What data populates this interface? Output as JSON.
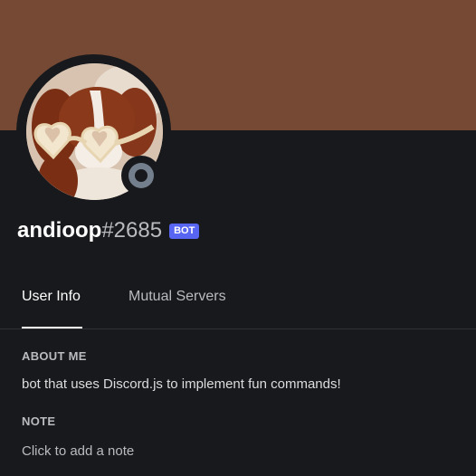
{
  "profile": {
    "username": "andioop",
    "discriminator": "#2685",
    "bot_tag": "BOT",
    "banner_color": "#754933",
    "status": "offline",
    "avatar_icon": "puppy-with-heart-sunglasses-avatar"
  },
  "tabs": [
    {
      "label": "User Info",
      "active": true
    },
    {
      "label": "Mutual Servers",
      "active": false
    }
  ],
  "about": {
    "title": "ABOUT ME",
    "text": "bot that uses Discord.js to implement fun commands!"
  },
  "note": {
    "title": "NOTE",
    "placeholder": "Click to add a note",
    "value": ""
  },
  "colors": {
    "background": "#18191c",
    "bot_tag": "#5865f2",
    "status_offline": "#747f8d"
  }
}
